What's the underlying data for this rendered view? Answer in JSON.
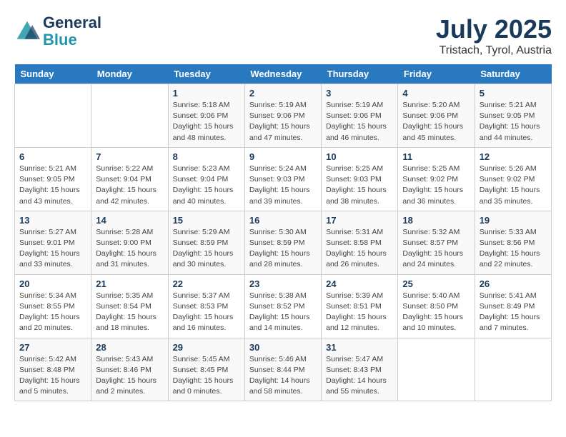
{
  "header": {
    "logo_line1": "General",
    "logo_line2": "Blue",
    "month": "July 2025",
    "location": "Tristach, Tyrol, Austria"
  },
  "days_of_week": [
    "Sunday",
    "Monday",
    "Tuesday",
    "Wednesday",
    "Thursday",
    "Friday",
    "Saturday"
  ],
  "weeks": [
    [
      {
        "day": "",
        "info": ""
      },
      {
        "day": "",
        "info": ""
      },
      {
        "day": "1",
        "info": "Sunrise: 5:18 AM\nSunset: 9:06 PM\nDaylight: 15 hours\nand 48 minutes."
      },
      {
        "day": "2",
        "info": "Sunrise: 5:19 AM\nSunset: 9:06 PM\nDaylight: 15 hours\nand 47 minutes."
      },
      {
        "day": "3",
        "info": "Sunrise: 5:19 AM\nSunset: 9:06 PM\nDaylight: 15 hours\nand 46 minutes."
      },
      {
        "day": "4",
        "info": "Sunrise: 5:20 AM\nSunset: 9:06 PM\nDaylight: 15 hours\nand 45 minutes."
      },
      {
        "day": "5",
        "info": "Sunrise: 5:21 AM\nSunset: 9:05 PM\nDaylight: 15 hours\nand 44 minutes."
      }
    ],
    [
      {
        "day": "6",
        "info": "Sunrise: 5:21 AM\nSunset: 9:05 PM\nDaylight: 15 hours\nand 43 minutes."
      },
      {
        "day": "7",
        "info": "Sunrise: 5:22 AM\nSunset: 9:04 PM\nDaylight: 15 hours\nand 42 minutes."
      },
      {
        "day": "8",
        "info": "Sunrise: 5:23 AM\nSunset: 9:04 PM\nDaylight: 15 hours\nand 40 minutes."
      },
      {
        "day": "9",
        "info": "Sunrise: 5:24 AM\nSunset: 9:03 PM\nDaylight: 15 hours\nand 39 minutes."
      },
      {
        "day": "10",
        "info": "Sunrise: 5:25 AM\nSunset: 9:03 PM\nDaylight: 15 hours\nand 38 minutes."
      },
      {
        "day": "11",
        "info": "Sunrise: 5:25 AM\nSunset: 9:02 PM\nDaylight: 15 hours\nand 36 minutes."
      },
      {
        "day": "12",
        "info": "Sunrise: 5:26 AM\nSunset: 9:02 PM\nDaylight: 15 hours\nand 35 minutes."
      }
    ],
    [
      {
        "day": "13",
        "info": "Sunrise: 5:27 AM\nSunset: 9:01 PM\nDaylight: 15 hours\nand 33 minutes."
      },
      {
        "day": "14",
        "info": "Sunrise: 5:28 AM\nSunset: 9:00 PM\nDaylight: 15 hours\nand 31 minutes."
      },
      {
        "day": "15",
        "info": "Sunrise: 5:29 AM\nSunset: 8:59 PM\nDaylight: 15 hours\nand 30 minutes."
      },
      {
        "day": "16",
        "info": "Sunrise: 5:30 AM\nSunset: 8:59 PM\nDaylight: 15 hours\nand 28 minutes."
      },
      {
        "day": "17",
        "info": "Sunrise: 5:31 AM\nSunset: 8:58 PM\nDaylight: 15 hours\nand 26 minutes."
      },
      {
        "day": "18",
        "info": "Sunrise: 5:32 AM\nSunset: 8:57 PM\nDaylight: 15 hours\nand 24 minutes."
      },
      {
        "day": "19",
        "info": "Sunrise: 5:33 AM\nSunset: 8:56 PM\nDaylight: 15 hours\nand 22 minutes."
      }
    ],
    [
      {
        "day": "20",
        "info": "Sunrise: 5:34 AM\nSunset: 8:55 PM\nDaylight: 15 hours\nand 20 minutes."
      },
      {
        "day": "21",
        "info": "Sunrise: 5:35 AM\nSunset: 8:54 PM\nDaylight: 15 hours\nand 18 minutes."
      },
      {
        "day": "22",
        "info": "Sunrise: 5:37 AM\nSunset: 8:53 PM\nDaylight: 15 hours\nand 16 minutes."
      },
      {
        "day": "23",
        "info": "Sunrise: 5:38 AM\nSunset: 8:52 PM\nDaylight: 15 hours\nand 14 minutes."
      },
      {
        "day": "24",
        "info": "Sunrise: 5:39 AM\nSunset: 8:51 PM\nDaylight: 15 hours\nand 12 minutes."
      },
      {
        "day": "25",
        "info": "Sunrise: 5:40 AM\nSunset: 8:50 PM\nDaylight: 15 hours\nand 10 minutes."
      },
      {
        "day": "26",
        "info": "Sunrise: 5:41 AM\nSunset: 8:49 PM\nDaylight: 15 hours\nand 7 minutes."
      }
    ],
    [
      {
        "day": "27",
        "info": "Sunrise: 5:42 AM\nSunset: 8:48 PM\nDaylight: 15 hours\nand 5 minutes."
      },
      {
        "day": "28",
        "info": "Sunrise: 5:43 AM\nSunset: 8:46 PM\nDaylight: 15 hours\nand 2 minutes."
      },
      {
        "day": "29",
        "info": "Sunrise: 5:45 AM\nSunset: 8:45 PM\nDaylight: 15 hours\nand 0 minutes."
      },
      {
        "day": "30",
        "info": "Sunrise: 5:46 AM\nSunset: 8:44 PM\nDaylight: 14 hours\nand 58 minutes."
      },
      {
        "day": "31",
        "info": "Sunrise: 5:47 AM\nSunset: 8:43 PM\nDaylight: 14 hours\nand 55 minutes."
      },
      {
        "day": "",
        "info": ""
      },
      {
        "day": "",
        "info": ""
      }
    ]
  ]
}
